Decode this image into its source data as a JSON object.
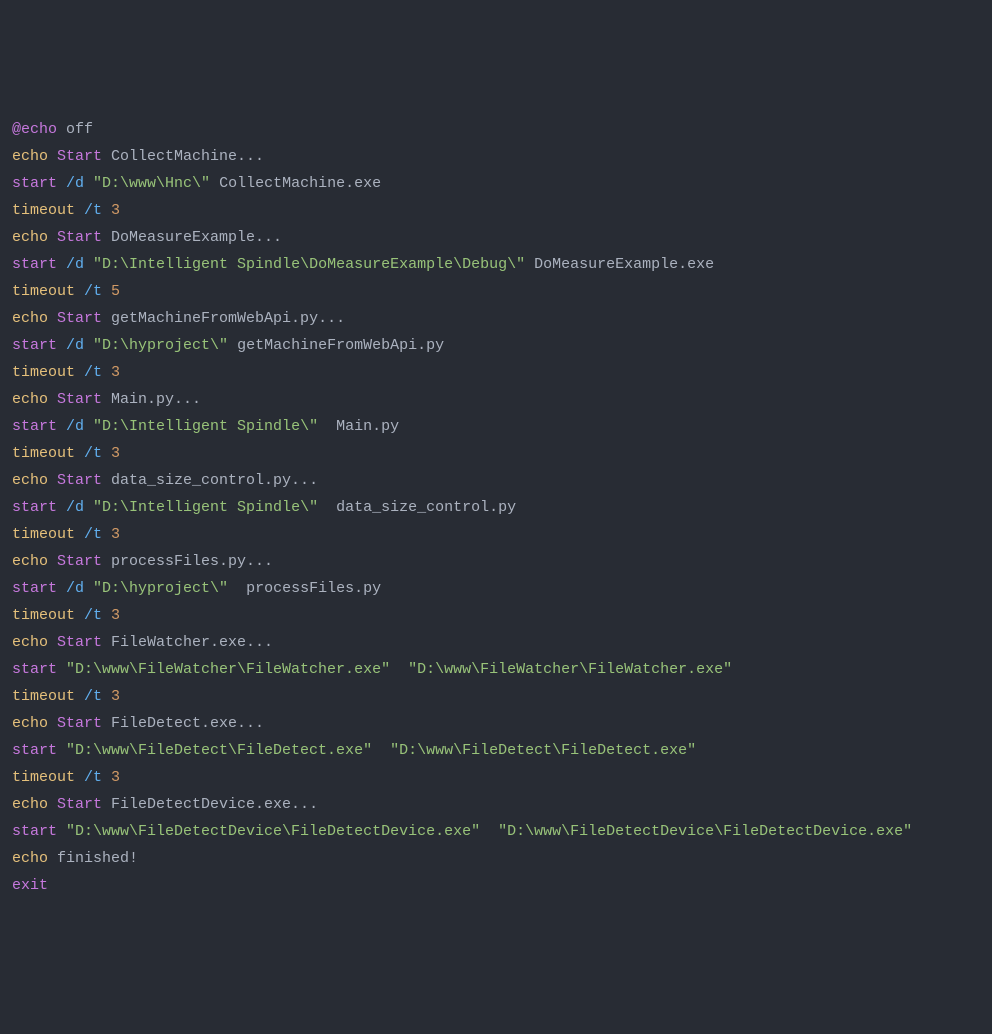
{
  "code": {
    "lines": [
      [
        {
          "cls": "t-at",
          "key": "at",
          "text": "@echo "
        },
        {
          "cls": "t-plain",
          "key": "off",
          "text": "off"
        }
      ],
      [
        {
          "cls": "t-cmd",
          "key": "echo",
          "text": "echo "
        },
        {
          "cls": "t-key",
          "key": "start",
          "text": "Start "
        },
        {
          "cls": "t-plain",
          "key": "rest",
          "text": "CollectMachine..."
        }
      ],
      [
        {
          "cls": "t-key",
          "key": "start",
          "text": "start "
        },
        {
          "cls": "t-flag",
          "key": "flag",
          "text": "/d "
        },
        {
          "cls": "t-str",
          "key": "path",
          "text": "\"D:\\www\\Hnc\\\" "
        },
        {
          "cls": "t-plain",
          "key": "exe",
          "text": "CollectMachine.exe"
        }
      ],
      [
        {
          "cls": "t-cmd",
          "key": "timeout",
          "text": "timeout "
        },
        {
          "cls": "t-flag",
          "key": "flag",
          "text": "/t "
        },
        {
          "cls": "t-num",
          "key": "num",
          "text": "3"
        }
      ],
      [
        {
          "cls": "t-cmd",
          "key": "echo",
          "text": "echo "
        },
        {
          "cls": "t-key",
          "key": "start",
          "text": "Start "
        },
        {
          "cls": "t-plain",
          "key": "rest",
          "text": "DoMeasureExample..."
        }
      ],
      [
        {
          "cls": "t-key",
          "key": "start",
          "text": "start "
        },
        {
          "cls": "t-flag",
          "key": "flag",
          "text": "/d "
        },
        {
          "cls": "t-str",
          "key": "path",
          "text": "\"D:\\Intelligent Spindle\\DoMeasureExample\\Debug\\\" "
        },
        {
          "cls": "t-plain",
          "key": "exe",
          "text": "DoMeasureExample.exe"
        }
      ],
      [
        {
          "cls": "t-cmd",
          "key": "timeout",
          "text": "timeout "
        },
        {
          "cls": "t-flag",
          "key": "flag",
          "text": "/t "
        },
        {
          "cls": "t-num",
          "key": "num",
          "text": "5"
        }
      ],
      [
        {
          "cls": "t-cmd",
          "key": "echo",
          "text": "echo "
        },
        {
          "cls": "t-key",
          "key": "start",
          "text": "Start "
        },
        {
          "cls": "t-plain",
          "key": "rest",
          "text": "getMachineFromWebApi.py..."
        }
      ],
      [
        {
          "cls": "t-key",
          "key": "start",
          "text": "start "
        },
        {
          "cls": "t-flag",
          "key": "flag",
          "text": "/d "
        },
        {
          "cls": "t-str",
          "key": "path",
          "text": "\"D:\\hyproject\\\" "
        },
        {
          "cls": "t-plain",
          "key": "exe",
          "text": "getMachineFromWebApi.py"
        }
      ],
      [
        {
          "cls": "t-cmd",
          "key": "timeout",
          "text": "timeout "
        },
        {
          "cls": "t-flag",
          "key": "flag",
          "text": "/t "
        },
        {
          "cls": "t-num",
          "key": "num",
          "text": "3"
        }
      ],
      [
        {
          "cls": "t-cmd",
          "key": "echo",
          "text": "echo "
        },
        {
          "cls": "t-key",
          "key": "start",
          "text": "Start "
        },
        {
          "cls": "t-plain",
          "key": "rest",
          "text": "Main.py..."
        }
      ],
      [
        {
          "cls": "t-key",
          "key": "start",
          "text": "start "
        },
        {
          "cls": "t-flag",
          "key": "flag",
          "text": "/d "
        },
        {
          "cls": "t-str",
          "key": "path",
          "text": "\"D:\\Intelligent Spindle\\\"  "
        },
        {
          "cls": "t-plain",
          "key": "exe",
          "text": "Main.py"
        }
      ],
      [
        {
          "cls": "t-cmd",
          "key": "timeout",
          "text": "timeout "
        },
        {
          "cls": "t-flag",
          "key": "flag",
          "text": "/t "
        },
        {
          "cls": "t-num",
          "key": "num",
          "text": "3"
        }
      ],
      [
        {
          "cls": "t-cmd",
          "key": "echo",
          "text": "echo "
        },
        {
          "cls": "t-key",
          "key": "start",
          "text": "Start "
        },
        {
          "cls": "t-plain",
          "key": "rest",
          "text": "data_size_control.py..."
        }
      ],
      [
        {
          "cls": "t-key",
          "key": "start",
          "text": "start "
        },
        {
          "cls": "t-flag",
          "key": "flag",
          "text": "/d "
        },
        {
          "cls": "t-str",
          "key": "path",
          "text": "\"D:\\Intelligent Spindle\\\"  "
        },
        {
          "cls": "t-plain",
          "key": "exe",
          "text": "data_size_control.py"
        }
      ],
      [
        {
          "cls": "t-cmd",
          "key": "timeout",
          "text": "timeout "
        },
        {
          "cls": "t-flag",
          "key": "flag",
          "text": "/t "
        },
        {
          "cls": "t-num",
          "key": "num",
          "text": "3"
        }
      ],
      [
        {
          "cls": "t-cmd",
          "key": "echo",
          "text": "echo "
        },
        {
          "cls": "t-key",
          "key": "start",
          "text": "Start "
        },
        {
          "cls": "t-plain",
          "key": "rest",
          "text": "processFiles.py..."
        }
      ],
      [
        {
          "cls": "t-key",
          "key": "start",
          "text": "start "
        },
        {
          "cls": "t-flag",
          "key": "flag",
          "text": "/d "
        },
        {
          "cls": "t-str",
          "key": "path",
          "text": "\"D:\\hyproject\\\"  "
        },
        {
          "cls": "t-plain",
          "key": "exe",
          "text": "processFiles.py"
        }
      ],
      [
        {
          "cls": "t-cmd",
          "key": "timeout",
          "text": "timeout "
        },
        {
          "cls": "t-flag",
          "key": "flag",
          "text": "/t "
        },
        {
          "cls": "t-num",
          "key": "num",
          "text": "3"
        }
      ],
      [
        {
          "cls": "t-cmd",
          "key": "echo",
          "text": "echo "
        },
        {
          "cls": "t-key",
          "key": "start",
          "text": "Start "
        },
        {
          "cls": "t-plain",
          "key": "rest",
          "text": "FileWatcher.exe..."
        }
      ],
      [
        {
          "cls": "t-key",
          "key": "start",
          "text": "start "
        },
        {
          "cls": "t-str",
          "key": "path1",
          "text": "\"D:\\www\\FileWatcher\\FileWatcher.exe\"  "
        },
        {
          "cls": "t-str",
          "key": "path2",
          "text": "\"D:\\www\\FileWatcher\\FileWatcher.exe\""
        }
      ],
      [
        {
          "cls": "t-cmd",
          "key": "timeout",
          "text": "timeout "
        },
        {
          "cls": "t-flag",
          "key": "flag",
          "text": "/t "
        },
        {
          "cls": "t-num",
          "key": "num",
          "text": "3"
        }
      ],
      [
        {
          "cls": "t-cmd",
          "key": "echo",
          "text": "echo "
        },
        {
          "cls": "t-key",
          "key": "start",
          "text": "Start "
        },
        {
          "cls": "t-plain",
          "key": "rest",
          "text": "FileDetect.exe..."
        }
      ],
      [
        {
          "cls": "t-key",
          "key": "start",
          "text": "start "
        },
        {
          "cls": "t-str",
          "key": "path1",
          "text": "\"D:\\www\\FileDetect\\FileDetect.exe\"  "
        },
        {
          "cls": "t-str",
          "key": "path2",
          "text": "\"D:\\www\\FileDetect\\FileDetect.exe\""
        }
      ],
      [
        {
          "cls": "t-cmd",
          "key": "timeout",
          "text": "timeout "
        },
        {
          "cls": "t-flag",
          "key": "flag",
          "text": "/t "
        },
        {
          "cls": "t-num",
          "key": "num",
          "text": "3"
        }
      ],
      [
        {
          "cls": "t-cmd",
          "key": "echo",
          "text": "echo "
        },
        {
          "cls": "t-key",
          "key": "start",
          "text": "Start "
        },
        {
          "cls": "t-plain",
          "key": "rest",
          "text": "FileDetectDevice.exe..."
        }
      ],
      [
        {
          "cls": "t-key",
          "key": "start",
          "text": "start "
        },
        {
          "cls": "t-str",
          "key": "path1",
          "text": "\"D:\\www\\FileDetectDevice\\FileDetectDevice.exe\"  "
        },
        {
          "cls": "t-str",
          "key": "path2",
          "text": "\"D:\\www\\FileDetectDevice\\FileDetectDevice.exe\""
        }
      ],
      [
        {
          "cls": "t-cmd",
          "key": "echo",
          "text": "echo "
        },
        {
          "cls": "t-plain",
          "key": "rest",
          "text": "finished!"
        }
      ],
      [
        {
          "cls": "t-key",
          "key": "exit",
          "text": "exit"
        }
      ]
    ]
  }
}
